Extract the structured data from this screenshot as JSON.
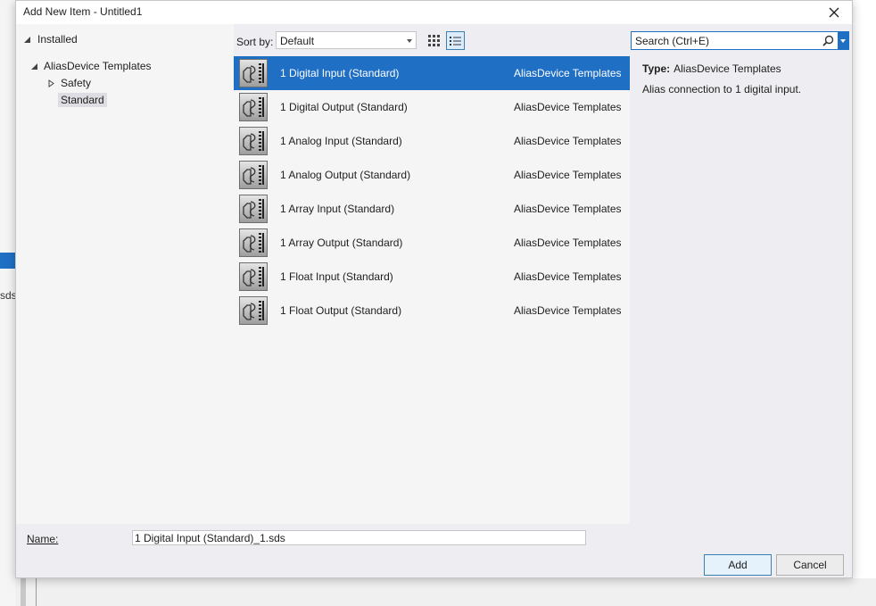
{
  "background": {
    "fragment_text": "sds"
  },
  "dialog": {
    "title": "Add New Item - Untitled1",
    "close_glyph": "✕"
  },
  "tree": {
    "header": "Installed",
    "root": "AliasDevice Templates",
    "children": [
      "Safety",
      "Standard"
    ],
    "selected": "Standard"
  },
  "toolbar": {
    "sort_label": "Sort by:",
    "sort_value": "Default",
    "view_modes": [
      "grid-view-icon",
      "list-view-icon"
    ],
    "active_view": "list"
  },
  "search": {
    "placeholder": "Search (Ctrl+E)"
  },
  "templates": [
    {
      "name": "1 Digital Input (Standard)",
      "category": "AliasDevice Templates"
    },
    {
      "name": "1 Digital Output (Standard)",
      "category": "AliasDevice Templates"
    },
    {
      "name": "1 Analog Input (Standard)",
      "category": "AliasDevice Templates"
    },
    {
      "name": "1 Analog Output (Standard)",
      "category": "AliasDevice Templates"
    },
    {
      "name": "1 Array Input (Standard)",
      "category": "AliasDevice Templates"
    },
    {
      "name": "1 Array Output (Standard)",
      "category": "AliasDevice Templates"
    },
    {
      "name": "1 Float Input (Standard)",
      "category": "AliasDevice Templates"
    },
    {
      "name": "1 Float Output (Standard)",
      "category": "AliasDevice Templates"
    }
  ],
  "selected_index": 0,
  "details": {
    "type_label": "Type:",
    "type_value": "AliasDevice Templates",
    "description": "Alias connection to 1 digital input."
  },
  "footer": {
    "name_label": "Name:",
    "name_value": "1 Digital Input (Standard)_1.sds",
    "add_label": "Add",
    "cancel_label": "Cancel"
  },
  "colors": {
    "accent": "#1f6fc5",
    "dialog_bg": "#eeeef2",
    "pane_bg": "#f5f5f5"
  }
}
